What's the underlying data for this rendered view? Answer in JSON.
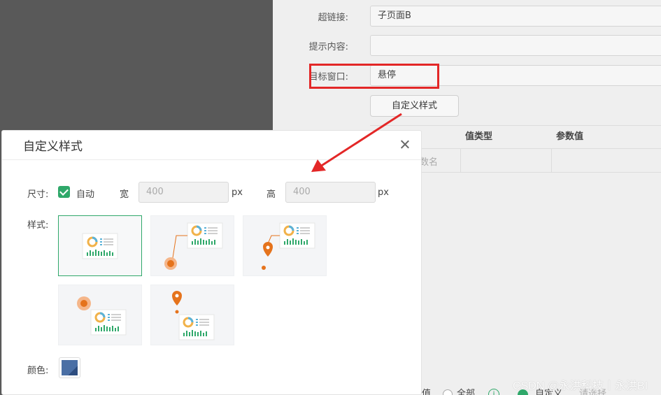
{
  "background": {
    "rows": [
      {
        "label": "超链接:",
        "value": ""
      },
      {
        "label": "提示内容:",
        "value": ""
      },
      {
        "label": "目标窗口:",
        "value": ""
      }
    ],
    "hyperlink_value": "子页面B",
    "target_window_value": "悬停",
    "custom_style_button": "自定义样式",
    "table_headers": [
      "值类型",
      "参数值"
    ],
    "table_cell_fragment": "数名",
    "footer": {
      "left": "值",
      "all_label": "全部",
      "custom_label": "自定义",
      "select_placeholder": "请选择"
    }
  },
  "modal": {
    "title": "自定义样式",
    "size_label": "尺寸:",
    "auto_label": "自动",
    "auto_checked": true,
    "width_label": "宽",
    "width_value": "400",
    "width_unit": "px",
    "height_label": "高",
    "height_value": "400",
    "height_unit": "px",
    "style_label": "样式:",
    "style_options": [
      "no-pointer",
      "circle-pointer-bottom-left",
      "pin-pointer-bottom-left",
      "circle-pointer-top-left",
      "pin-pointer-top-left"
    ],
    "selected_style_index": 0,
    "color_label": "颜色:",
    "color_value": "#4a6fa5"
  },
  "watermark": "CSDN @永洪科技丨永洪BI",
  "colors": {
    "accent": "#2fa86a",
    "highlight": "#e32727",
    "pointer": "#e5731c"
  }
}
